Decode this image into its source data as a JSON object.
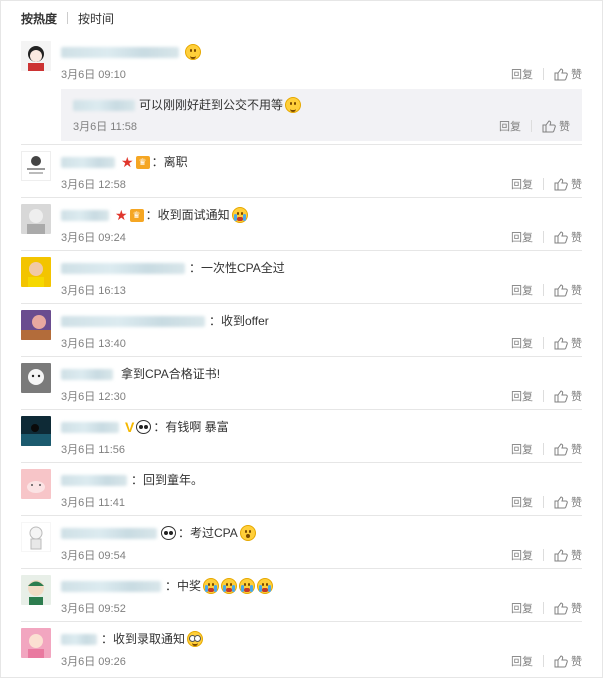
{
  "sort": {
    "hot": "按热度",
    "time": "按时间"
  },
  "actions": {
    "reply": "回复",
    "like": "赞"
  },
  "comments": [
    {
      "text": "",
      "time": "3月6日 09:10",
      "reply": {
        "text": "可以刚刚好赶到公交不用等",
        "time": "3月6日 11:58"
      }
    },
    {
      "text": "：离职",
      "time": "3月6日 12:58"
    },
    {
      "text": "：收到面试通知",
      "time": "3月6日 09:24"
    },
    {
      "text": "：一次性CPA全过",
      "time": "3月6日 16:13"
    },
    {
      "text": "：收到offer",
      "time": "3月6日 13:40"
    },
    {
      "text": "拿到CPA合格证书!",
      "time": "3月6日 12:30"
    },
    {
      "text": "：有钱啊 暴富",
      "time": "3月6日 11:56"
    },
    {
      "text": "：回到童年。",
      "time": "3月6日 11:41"
    },
    {
      "text": "：考过CPA",
      "time": "3月6日 09:54"
    },
    {
      "text": "：中奖",
      "time": "3月6日 09:52"
    },
    {
      "text": "：收到录取通知",
      "time": "3月6日 09:26"
    }
  ],
  "colors": {
    "meta": "#808080",
    "divider": "#e6e6e6",
    "subbg": "#f2f2f5"
  }
}
